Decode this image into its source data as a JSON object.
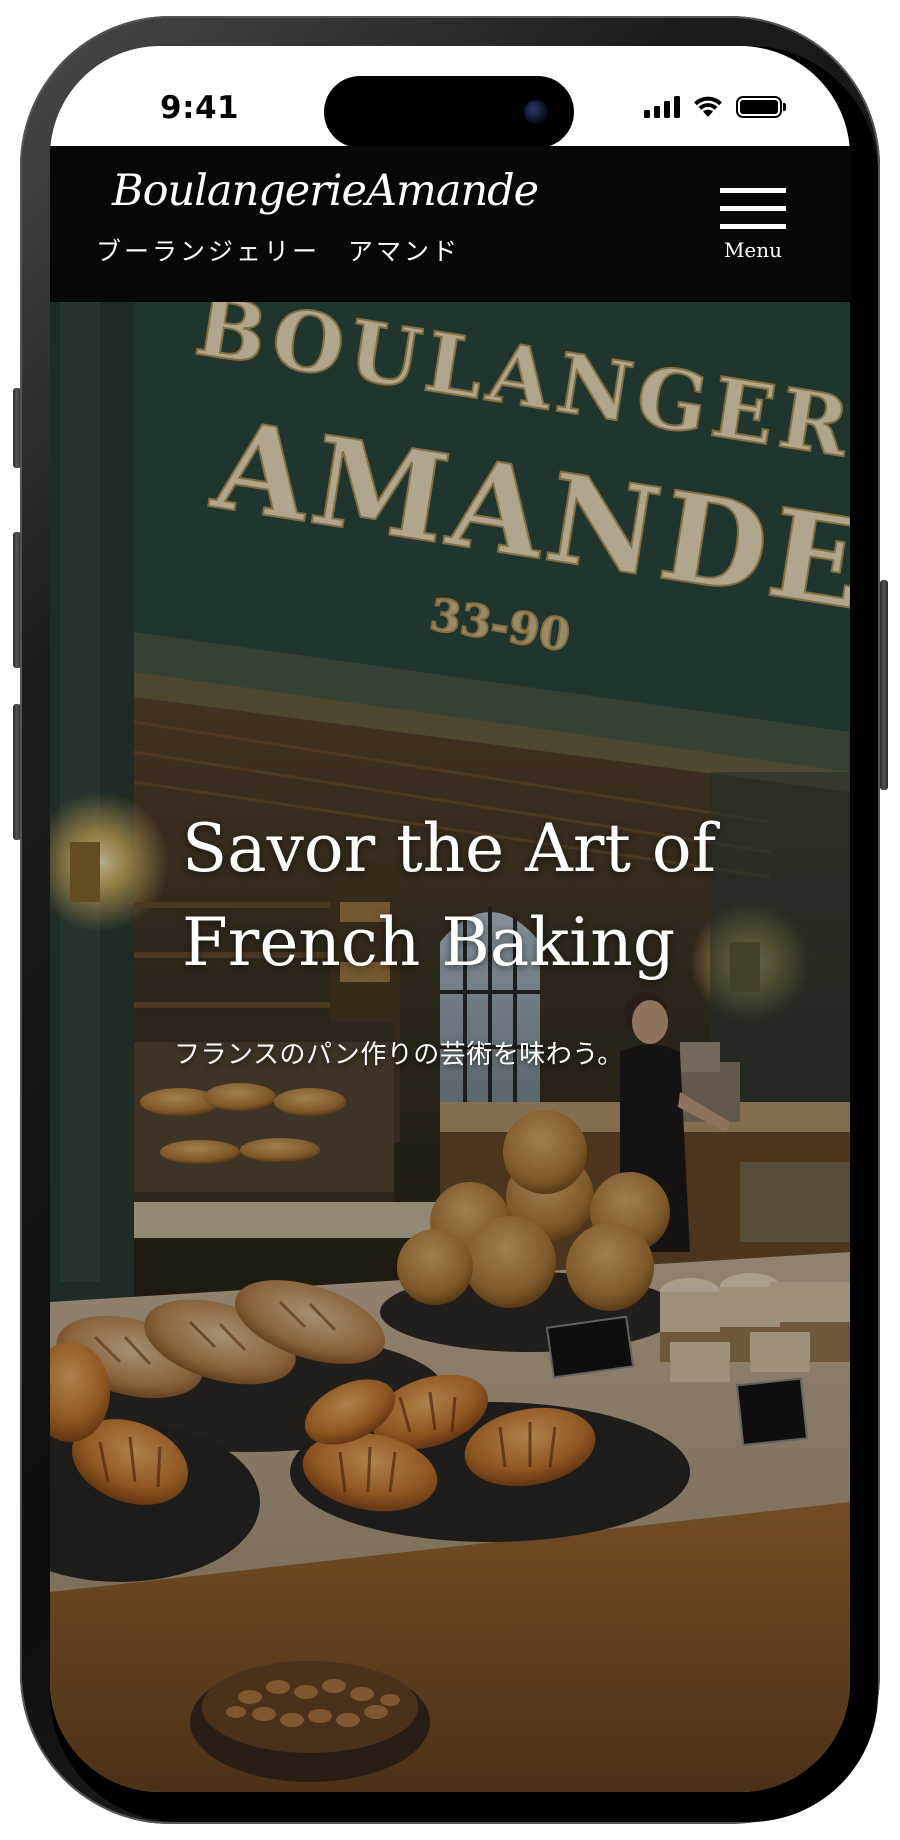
{
  "status_bar": {
    "time": "9:41"
  },
  "header": {
    "logo_script": "BoulangerieAmande",
    "logo_kana": "ブーランジェリー　アマンド",
    "menu_label": "Menu"
  },
  "hero": {
    "title_line1": "Savor the Art of",
    "title_line2": "French Baking",
    "subtitle": "フランスのパン作りの芸術を味わう。",
    "sign_line1": "BOULANGERIE",
    "sign_line2": "AMANDE",
    "sign_number": "33-90"
  },
  "colors": {
    "header_bg": "#070707",
    "header_text": "#ffffff",
    "sign_wall": "#2f4a42",
    "sign_letters": "#f3e6c4",
    "wood": "#8a5a2c"
  },
  "icons": [
    "signal-icon",
    "wifi-icon",
    "battery-icon",
    "hamburger-menu-icon"
  ]
}
